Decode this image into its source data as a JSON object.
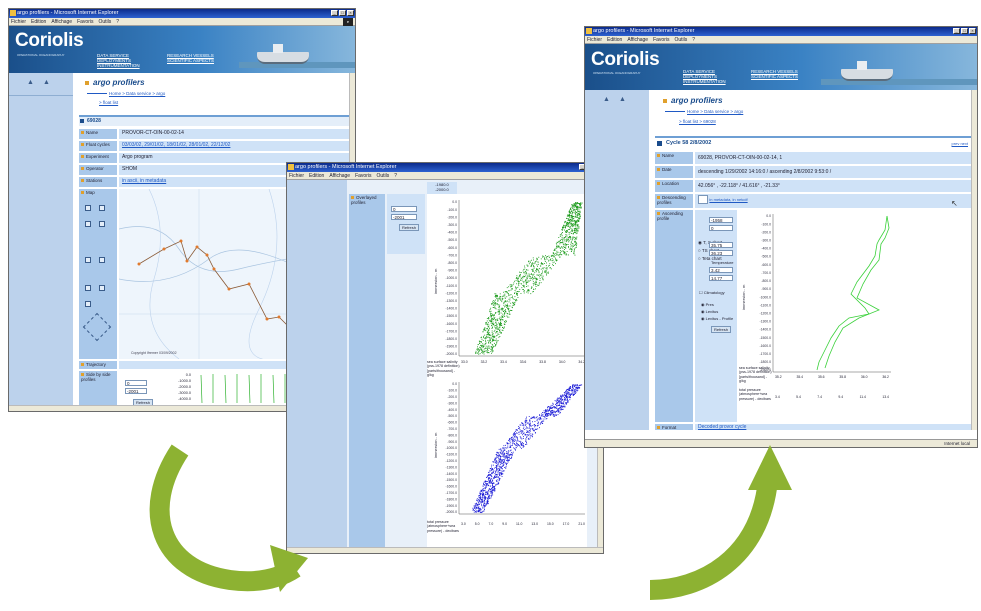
{
  "win1": {
    "title": "argo profilers - Microsoft Internet Explorer",
    "menu": [
      "Fichier",
      "Edition",
      "Affichage",
      "Favoris",
      "Outils",
      "?"
    ],
    "brand": "Coriolis",
    "brand_sub": "OPERATIONAL OCEANOGRAPHY",
    "nav": [
      "DATA SERVICE",
      "DEPLOYMENTS",
      "INSTRUMENTATION",
      "RESEARCH VESSELS",
      "SCIENTIFIC ASPECTS"
    ],
    "heading": "argo profilers",
    "crumb": "Home > Data service > argo",
    "crumb2": "> float list",
    "float_id": "69028",
    "rows": [
      {
        "label": "Name",
        "value": "PROVOR-CT-OIN-00-02-14"
      },
      {
        "label": "Float cycles",
        "value": "03/03/02, 29/01/02, 18/01/02, 28/01/02, 22/12/02"
      },
      {
        "label": "Experiment",
        "value": "Argo program"
      },
      {
        "label": "Operator",
        "value": "SHOM"
      },
      {
        "label": "Stations",
        "value": "in ascii, in metadata"
      }
    ],
    "map_label": "Map",
    "copyright": "Copyright Ifremer 03/09/2002",
    "trajectory_label": "Trajectory",
    "side_label": "Side by side profiles",
    "inputs": [
      "0",
      "-2001"
    ],
    "refresh": "Refresh",
    "depth_ticks": [
      "0.0",
      "-1000.0",
      "-2000.0",
      "-3000.0",
      "-4000.0"
    ]
  },
  "win2": {
    "title": "argo profilers - Microsoft Internet Explorer",
    "menu": [
      "Fichier",
      "Edition",
      "Affichage",
      "Favoris",
      "Outils",
      "?"
    ],
    "row_label": "Overlayed profiles",
    "inputs": [
      "0",
      "-2001"
    ],
    "refresh": "Refresh",
    "top_value": "-1980.0",
    "top_value2": "-2000.0",
    "y_axis_label": "immersion - m",
    "y_ticks": [
      "0.0",
      "-100.0",
      "-200.0",
      "-300.0",
      "-400.0",
      "-500.0",
      "-600.0",
      "-700.0",
      "-800.0",
      "-900.0",
      "-1000.0",
      "-1100.0",
      "-1200.0",
      "-1300.0",
      "-1400.0",
      "-1500.0",
      "-1600.0",
      "-1700.0",
      "-1800.0",
      "-1900.0",
      "-2000.0"
    ],
    "sal_label": "sea surface salinity (pss-1978 definition) [parts/thousand] - g/kg",
    "sal_ticks": [
      "33.0",
      "33.2",
      "33.4",
      "33.6",
      "33.8",
      "34.0",
      "34.2"
    ],
    "temp_label": "total pressure (atmosphere+sea pressure) - decibars",
    "temp_ticks": [
      "3.0",
      "5.0",
      "7.0",
      "9.0",
      "11.0",
      "13.0",
      "15.0",
      "17.0",
      "21.0"
    ]
  },
  "win3": {
    "title": "argo profilers - Microsoft Internet Explorer",
    "menu": [
      "Fichier",
      "Edition",
      "Affichage",
      "Favoris",
      "Outils",
      "?"
    ],
    "brand": "Coriolis",
    "brand_sub": "OPERATIONAL OCEANOGRAPHY",
    "nav": [
      "DATA SERVICE",
      "DEPLOYMENTS",
      "INSTRUMENTATION",
      "RESEARCH VESSELS",
      "SCIENTIFIC ASPECTS"
    ],
    "heading": "argo profilers",
    "crumb": "Home > Data service > argo",
    "crumb2": "> float list > 69028",
    "cycle_title": "Cycle 58 2/8/2002",
    "prev_next": "prev  next",
    "rows": [
      {
        "label": "Name",
        "value": "69028, PROVOR-CT-OIN-00-02-14, 1"
      },
      {
        "label": "Date",
        "value": "descending 1/29/2002 14:16:0 / ascending 2/8/2002 9:53:0 /"
      },
      {
        "label": "Location",
        "value": "42.056° , -22.118° / 41.616° , -21.33°"
      }
    ],
    "descending_label": "Descending profiles",
    "descending_value": "in metadata, in netcdf",
    "ascending_label": "Ascending profile",
    "radios": [
      "T, S chart",
      "TS chart",
      "Teta chart"
    ],
    "inputs": [
      "-1958",
      "0",
      "35.75",
      "36.23",
      "3.42",
      "14.77"
    ],
    "temperature_label": "Temperature",
    "check_label": "Climatology",
    "radio2": [
      "Pres",
      "Levitus",
      "Levitus - Profile"
    ],
    "refresh": "Refresh",
    "y_axis_label": "immersion - m",
    "y_ticks": [
      "0.0",
      "-100.0",
      "-200.0",
      "-300.0",
      "-400.0",
      "-500.0",
      "-600.0",
      "-700.0",
      "-800.0",
      "-900.0",
      "-1000.0",
      "-1100.0",
      "-1200.0",
      "-1300.0",
      "-1400.0",
      "-1500.0",
      "-1600.0",
      "-1700.0",
      "-1800.0",
      "-1900.0"
    ],
    "sal_label": "sea surface salinity (pss-1978 definition) [parts/thousand] - g/kg",
    "sal_ticks": [
      "35.4",
      "35.6",
      "35.8",
      "36.0",
      "36.2",
      "35.2"
    ],
    "temp_label": "total pressure (atmosphere+sea pressure) - decibars",
    "temp_ticks": [
      "3.4",
      "5.4",
      "7.4",
      "9.4",
      "11.4",
      "13.4"
    ],
    "format_label": "Format",
    "format_value": "Decoded provor cycle",
    "status": "Internet local"
  },
  "colors": {
    "accent": "#1a4c8c",
    "band": "#a9c8ea",
    "arrow": "#8db232"
  }
}
